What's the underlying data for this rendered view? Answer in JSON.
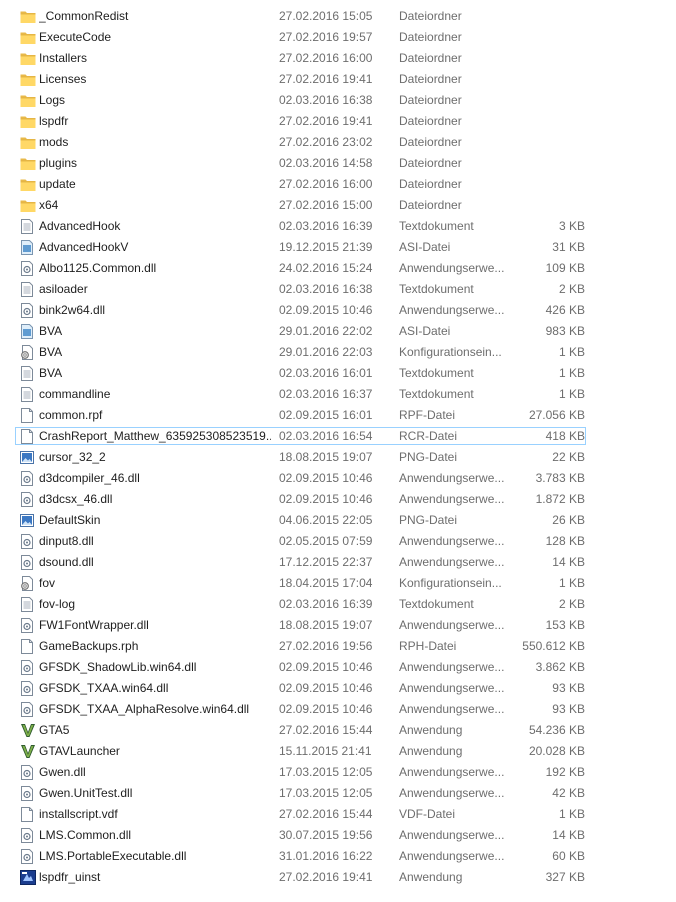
{
  "files": [
    {
      "name": "_CommonRedist",
      "date": "27.02.2016 15:05",
      "type": "Dateiordner",
      "size": "",
      "icon": "folder-icon"
    },
    {
      "name": "ExecuteCode",
      "date": "27.02.2016 19:57",
      "type": "Dateiordner",
      "size": "",
      "icon": "folder-icon"
    },
    {
      "name": "Installers",
      "date": "27.02.2016 16:00",
      "type": "Dateiordner",
      "size": "",
      "icon": "folder-icon"
    },
    {
      "name": "Licenses",
      "date": "27.02.2016 19:41",
      "type": "Dateiordner",
      "size": "",
      "icon": "folder-icon"
    },
    {
      "name": "Logs",
      "date": "02.03.2016 16:38",
      "type": "Dateiordner",
      "size": "",
      "icon": "folder-icon"
    },
    {
      "name": "lspdfr",
      "date": "27.02.2016 19:41",
      "type": "Dateiordner",
      "size": "",
      "icon": "folder-icon"
    },
    {
      "name": "mods",
      "date": "27.02.2016 23:02",
      "type": "Dateiordner",
      "size": "",
      "icon": "folder-icon"
    },
    {
      "name": "plugins",
      "date": "02.03.2016 14:58",
      "type": "Dateiordner",
      "size": "",
      "icon": "folder-icon"
    },
    {
      "name": "update",
      "date": "27.02.2016 16:00",
      "type": "Dateiordner",
      "size": "",
      "icon": "folder-icon"
    },
    {
      "name": "x64",
      "date": "27.02.2016 15:00",
      "type": "Dateiordner",
      "size": "",
      "icon": "folder-icon"
    },
    {
      "name": "AdvancedHook",
      "date": "02.03.2016 16:39",
      "type": "Textdokument",
      "size": "3 KB",
      "icon": "text-document-icon"
    },
    {
      "name": "AdvancedHookV",
      "date": "19.12.2015 21:39",
      "type": "ASI-Datei",
      "size": "31 KB",
      "icon": "asi-file-icon"
    },
    {
      "name": "Albo1125.Common.dll",
      "date": "24.02.2016 15:24",
      "type": "Anwendungserwe...",
      "size": "109 KB",
      "icon": "dll-icon"
    },
    {
      "name": "asiloader",
      "date": "02.03.2016 16:38",
      "type": "Textdokument",
      "size": "2 KB",
      "icon": "text-document-icon"
    },
    {
      "name": "bink2w64.dll",
      "date": "02.09.2015 10:46",
      "type": "Anwendungserwe...",
      "size": "426 KB",
      "icon": "dll-icon"
    },
    {
      "name": "BVA",
      "date": "29.01.2016 22:02",
      "type": "ASI-Datei",
      "size": "983 KB",
      "icon": "asi-file-icon"
    },
    {
      "name": "BVA",
      "date": "29.01.2016 22:03",
      "type": "Konfigurationsein...",
      "size": "1 KB",
      "icon": "config-file-icon"
    },
    {
      "name": "BVA",
      "date": "02.03.2016 16:01",
      "type": "Textdokument",
      "size": "1 KB",
      "icon": "text-document-icon"
    },
    {
      "name": "commandline",
      "date": "02.03.2016 16:37",
      "type": "Textdokument",
      "size": "1 KB",
      "icon": "text-document-icon"
    },
    {
      "name": "common.rpf",
      "date": "02.09.2015 16:01",
      "type": "RPF-Datei",
      "size": "27.056 KB",
      "icon": "blank-file-icon"
    },
    {
      "name": "CrashReport_Matthew_635925308523519...",
      "date": "02.03.2016 16:54",
      "type": "RCR-Datei",
      "size": "418 KB",
      "icon": "blank-file-icon",
      "selected": true
    },
    {
      "name": "cursor_32_2",
      "date": "18.08.2015 19:07",
      "type": "PNG-Datei",
      "size": "22 KB",
      "icon": "image-file-icon"
    },
    {
      "name": "d3dcompiler_46.dll",
      "date": "02.09.2015 10:46",
      "type": "Anwendungserwe...",
      "size": "3.783 KB",
      "icon": "dll-icon"
    },
    {
      "name": "d3dcsx_46.dll",
      "date": "02.09.2015 10:46",
      "type": "Anwendungserwe...",
      "size": "1.872 KB",
      "icon": "dll-icon"
    },
    {
      "name": "DefaultSkin",
      "date": "04.06.2015 22:05",
      "type": "PNG-Datei",
      "size": "26 KB",
      "icon": "image-file-icon"
    },
    {
      "name": "dinput8.dll",
      "date": "02.05.2015 07:59",
      "type": "Anwendungserwe...",
      "size": "128 KB",
      "icon": "dll-icon"
    },
    {
      "name": "dsound.dll",
      "date": "17.12.2015 22:37",
      "type": "Anwendungserwe...",
      "size": "14 KB",
      "icon": "dll-icon"
    },
    {
      "name": "fov",
      "date": "18.04.2015 17:04",
      "type": "Konfigurationsein...",
      "size": "1 KB",
      "icon": "config-file-icon"
    },
    {
      "name": "fov-log",
      "date": "02.03.2016 16:39",
      "type": "Textdokument",
      "size": "2 KB",
      "icon": "text-document-icon"
    },
    {
      "name": "FW1FontWrapper.dll",
      "date": "18.08.2015 19:07",
      "type": "Anwendungserwe...",
      "size": "153 KB",
      "icon": "dll-icon"
    },
    {
      "name": "GameBackups.rph",
      "date": "27.02.2016 19:56",
      "type": "RPH-Datei",
      "size": "550.612 KB",
      "icon": "blank-file-icon"
    },
    {
      "name": "GFSDK_ShadowLib.win64.dll",
      "date": "02.09.2015 10:46",
      "type": "Anwendungserwe...",
      "size": "3.862 KB",
      "icon": "dll-icon"
    },
    {
      "name": "GFSDK_TXAA.win64.dll",
      "date": "02.09.2015 10:46",
      "type": "Anwendungserwe...",
      "size": "93 KB",
      "icon": "dll-icon"
    },
    {
      "name": "GFSDK_TXAA_AlphaResolve.win64.dll",
      "date": "02.09.2015 10:46",
      "type": "Anwendungserwe...",
      "size": "93 KB",
      "icon": "dll-icon"
    },
    {
      "name": "GTA5",
      "date": "27.02.2016 15:44",
      "type": "Anwendung",
      "size": "54.236 KB",
      "icon": "gta-v-icon"
    },
    {
      "name": "GTAVLauncher",
      "date": "15.11.2015 21:41",
      "type": "Anwendung",
      "size": "20.028 KB",
      "icon": "gta-v-icon"
    },
    {
      "name": "Gwen.dll",
      "date": "17.03.2015 12:05",
      "type": "Anwendungserwe...",
      "size": "192 KB",
      "icon": "dll-icon"
    },
    {
      "name": "Gwen.UnitTest.dll",
      "date": "17.03.2015 12:05",
      "type": "Anwendungserwe...",
      "size": "42 KB",
      "icon": "dll-icon"
    },
    {
      "name": "installscript.vdf",
      "date": "27.02.2016 15:44",
      "type": "VDF-Datei",
      "size": "1 KB",
      "icon": "blank-file-icon"
    },
    {
      "name": "LMS.Common.dll",
      "date": "30.07.2015 19:56",
      "type": "Anwendungserwe...",
      "size": "14 KB",
      "icon": "dll-icon"
    },
    {
      "name": "LMS.PortableExecutable.dll",
      "date": "31.01.2016 16:22",
      "type": "Anwendungserwe...",
      "size": "60 KB",
      "icon": "dll-icon"
    },
    {
      "name": "lspdfr_uinst",
      "date": "27.02.2016 19:41",
      "type": "Anwendung",
      "size": "327 KB",
      "icon": "uninstaller-icon"
    }
  ]
}
